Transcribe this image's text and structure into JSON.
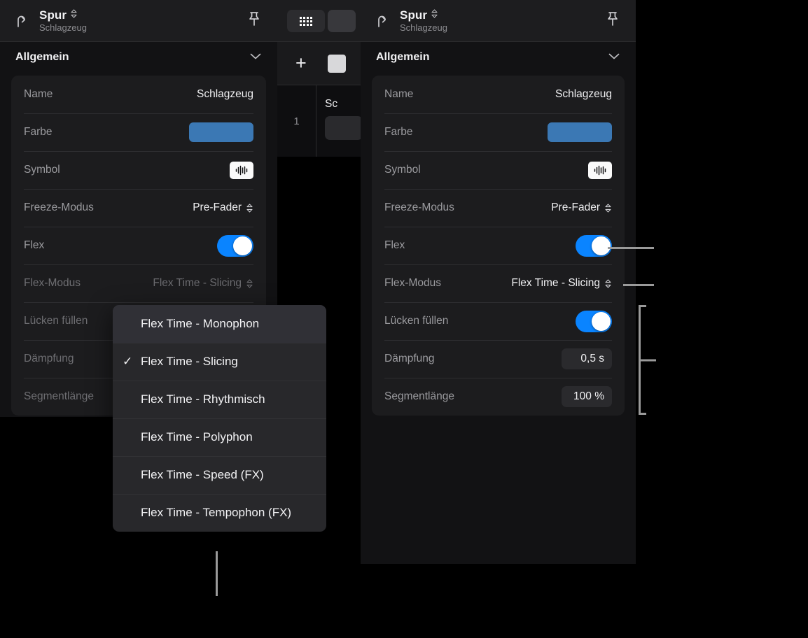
{
  "header": {
    "title": "Spur",
    "subtitle": "Schlagzeug",
    "back_icon": "back-arrow-icon",
    "stepper_icon": "chevron-up-down-icon",
    "pin_icon": "pin-icon"
  },
  "section": {
    "title": "Allgemein",
    "collapse_icon": "chevron-down-icon"
  },
  "colors": {
    "track_color": "#3b78b4",
    "toggle_on": "#0a84ff",
    "panel_bg": "#121214",
    "card_bg": "#1c1c1e",
    "callout": "#9a9a9a"
  },
  "left_panel": {
    "rows": [
      {
        "label": "Name",
        "value": "Schlagzeug",
        "kind": "text"
      },
      {
        "label": "Farbe",
        "value": "",
        "kind": "color"
      },
      {
        "label": "Symbol",
        "value": "",
        "kind": "symbol"
      },
      {
        "label": "Freeze-Modus",
        "value": "Pre-Fader",
        "kind": "popup"
      },
      {
        "label": "Flex",
        "value": "",
        "kind": "toggle"
      },
      {
        "label": "Flex-Modus",
        "value": "Flex Time - Slicing",
        "kind": "popup"
      },
      {
        "label": "Lücken füllen",
        "value": "",
        "kind": "toggle"
      },
      {
        "label": "Dämpfung",
        "value": "",
        "kind": "field"
      },
      {
        "label": "Segmentlänge",
        "value": "",
        "kind": "field"
      }
    ]
  },
  "right_panel": {
    "rows": [
      {
        "label": "Name",
        "value": "Schlagzeug",
        "kind": "text"
      },
      {
        "label": "Farbe",
        "value": "",
        "kind": "color"
      },
      {
        "label": "Symbol",
        "value": "",
        "kind": "symbol"
      },
      {
        "label": "Freeze-Modus",
        "value": "Pre-Fader",
        "kind": "popup"
      },
      {
        "label": "Flex",
        "value": "",
        "kind": "toggle"
      },
      {
        "label": "Flex-Modus",
        "value": "Flex Time - Slicing",
        "kind": "popup"
      },
      {
        "label": "Lücken füllen",
        "value": "",
        "kind": "toggle"
      },
      {
        "label": "Dämpfung",
        "value": "0,5 s",
        "kind": "field"
      },
      {
        "label": "Segmentlänge",
        "value": "100 %",
        "kind": "field"
      }
    ]
  },
  "middle_panel": {
    "grid_icon": "grid-dots-icon",
    "add_label": "+",
    "track_number": "1",
    "track_name": "Sc"
  },
  "dropdown": {
    "checked_index": 1,
    "highlight_index": 0,
    "check_glyph": "✓",
    "items": [
      "Flex Time - Monophon",
      "Flex Time - Slicing",
      "Flex Time - Rhythmisch",
      "Flex Time - Polyphon",
      "Flex Time - Speed (FX)",
      "Flex Time - Tempophon (FX)"
    ]
  }
}
